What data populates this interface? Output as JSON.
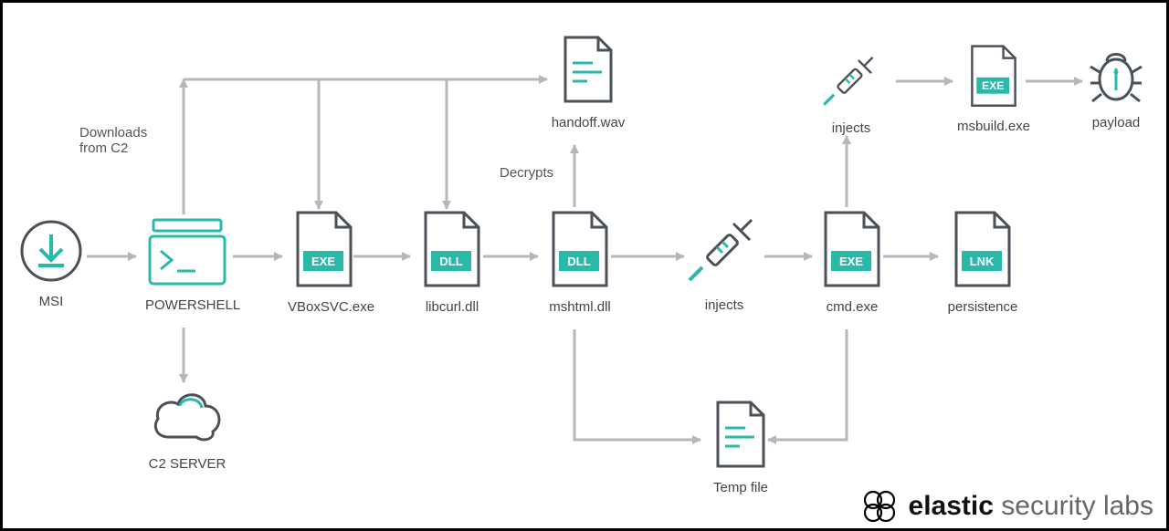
{
  "colors": {
    "line": "#b4b7bb",
    "outline": "#4a5159",
    "teal": "#29b9a9",
    "tealDark": "#2aa396"
  },
  "nodes": {
    "msi": {
      "label": "MSI"
    },
    "ps": {
      "label": "POWERSHELL"
    },
    "vbox": {
      "label": "VBoxSVC.exe",
      "badge": "EXE"
    },
    "libcurl": {
      "label": "libcurl.dll",
      "badge": "DLL"
    },
    "mshtml": {
      "label": "mshtml.dll",
      "badge": "DLL"
    },
    "injects1": {
      "label": "injects"
    },
    "cmd": {
      "label": "cmd.exe",
      "badge": "EXE"
    },
    "lnk": {
      "label": "persistence",
      "badge": "LNK"
    },
    "handoff": {
      "label": "handoff.wav"
    },
    "temp": {
      "label": "Temp file"
    },
    "c2": {
      "label": "C2 SERVER"
    },
    "injects2": {
      "label": "injects"
    },
    "msbuild": {
      "label": "msbuild.exe",
      "badge": "EXE"
    },
    "payload": {
      "label": "payload"
    }
  },
  "edgeLabels": {
    "downloads": "Downloads\nfrom C2",
    "decrypts": "Decrypts"
  },
  "attribution": {
    "bold": "elastic",
    "light": "security labs"
  }
}
